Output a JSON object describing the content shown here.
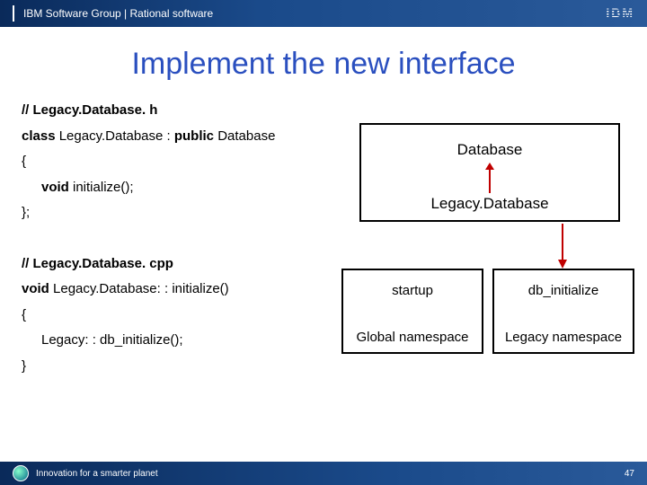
{
  "header": {
    "breadcrumb": "IBM Software Group | Rational software",
    "logo_text": "IBM"
  },
  "title": "Implement the new interface",
  "code_header": {
    "comment": "// Legacy.Database. h",
    "decl_prefix": "class",
    "decl_name": " Legacy.Database : ",
    "decl_keyword2": "public",
    "decl_base": " Database",
    "open_brace": "{",
    "member_kw": "void",
    "member_name": " initialize();",
    "close_brace": "};"
  },
  "code_impl": {
    "comment": "// Legacy.Database. cpp",
    "sig_kw": "void",
    "sig_name": " Legacy.Database: : initialize()",
    "open_brace": "{",
    "body": "Legacy: : db_initialize();",
    "close_brace": "}"
  },
  "diagram": {
    "database": "Database",
    "legacy_database": "Legacy.Database",
    "box_left_top": "startup",
    "box_left_bottom": "Global namespace",
    "box_right_top": "db_initialize",
    "box_right_bottom": "Legacy namespace"
  },
  "footer": {
    "tagline": "Innovation for a smarter planet",
    "page": "47"
  }
}
